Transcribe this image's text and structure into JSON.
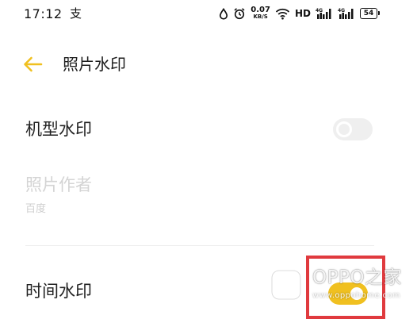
{
  "status_bar": {
    "time": "17:12",
    "app_glyph": "支",
    "net_speed_value": "0.07",
    "net_speed_unit": "KB/S",
    "hd_label": "HD",
    "sim1_label": "4G",
    "sim2_label": "4G",
    "battery_level": "54",
    "icons": [
      "water-drop-icon",
      "alarm-icon",
      "wifi-icon",
      "signal-icon",
      "battery-icon"
    ]
  },
  "header": {
    "back_icon": "back-arrow-icon",
    "title": "照片水印"
  },
  "settings": {
    "model_watermark": {
      "label": "机型水印",
      "enabled": false
    },
    "photo_author": {
      "label": "照片作者",
      "value": "百度",
      "disabled": true
    },
    "time_watermark": {
      "label": "时间水印",
      "enabled": true
    }
  },
  "watermark": {
    "brand": "OPPO之家",
    "url": "www.oppohome.com"
  },
  "colors": {
    "accent": "#f0c020",
    "highlight": "#e03a3e",
    "toggle_off": "#efefef",
    "disabled_text": "#d4d4d4"
  }
}
